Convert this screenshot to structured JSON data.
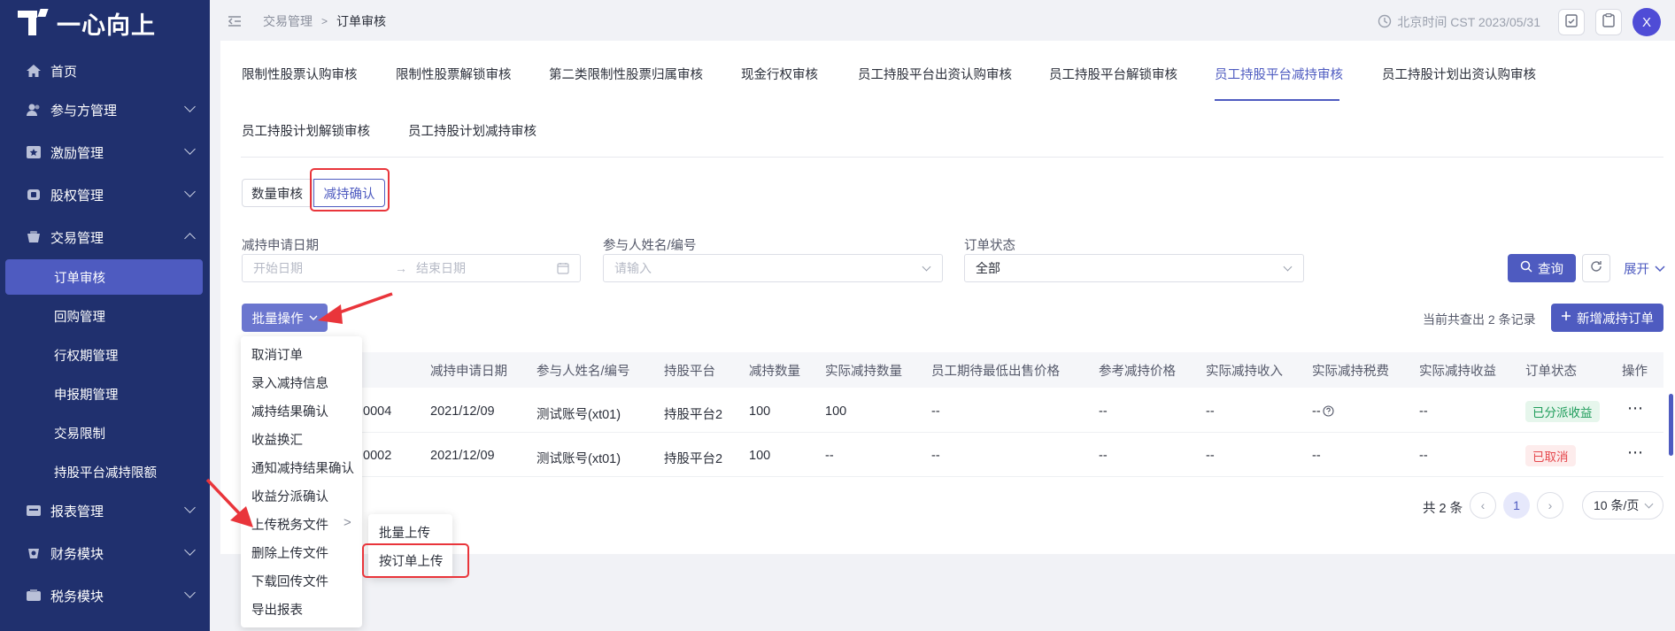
{
  "app": {
    "logo_text": "一心向上"
  },
  "sidebar": {
    "items": [
      {
        "label": "首页",
        "icon": "home-icon"
      },
      {
        "label": "参与方管理",
        "icon": "users-icon"
      },
      {
        "label": "激励管理",
        "icon": "star-icon"
      },
      {
        "label": "股权管理",
        "icon": "equity-icon"
      },
      {
        "label": "交易管理",
        "icon": "trade-icon"
      },
      {
        "label": "报表管理",
        "icon": "report-icon"
      },
      {
        "label": "财务模块",
        "icon": "finance-icon"
      },
      {
        "label": "税务模块",
        "icon": "tax-icon"
      }
    ],
    "sub_items": [
      "订单审核",
      "回购管理",
      "行权期管理",
      "申报期管理",
      "交易限制",
      "持股平台减持限额"
    ]
  },
  "topbar": {
    "breadcrumb": [
      "交易管理",
      "订单审核"
    ],
    "time": "北京时间 CST 2023/05/31",
    "avatar": "X"
  },
  "tabs": [
    "限制性股票认购审核",
    "限制性股票解锁审核",
    "第二类限制性股票归属审核",
    "现金行权审核",
    "员工持股平台出资认购审核",
    "员工持股平台解锁审核",
    "员工持股平台减持审核",
    "员工持股计划出资认购审核",
    "员工持股计划解锁审核",
    "员工持股计划减持审核"
  ],
  "segments": [
    "数量审核",
    "减持确认"
  ],
  "filters": {
    "date_label": "减持申请日期",
    "date_start_placeholder": "开始日期",
    "date_end_placeholder": "结束日期",
    "participant_label": "参与人姓名/编号",
    "participant_placeholder": "请输入",
    "status_label": "订单状态",
    "status_value": "全部",
    "query_button": "查询",
    "expand_link": "展开"
  },
  "toolbar": {
    "batch_button": "批量操作",
    "record_count": "当前共查出 2 条记录",
    "new_button": "新增减持订单"
  },
  "table": {
    "headers": [
      "减持申请日期",
      "参与人姓名/编号",
      "持股平台",
      "减持数量",
      "实际减持数量",
      "员工期待最低出售价格",
      "参考减持价格",
      "实际减持收入",
      "实际减持税费",
      "实际减持收益",
      "订单状态",
      "操作"
    ],
    "rows": [
      {
        "id_tail": "0004",
        "date": "2021/12/09",
        "participant": "测试账号(xt01)",
        "platform": "持股平台2",
        "qty": "100",
        "actual_qty": "100",
        "min_price": "--",
        "ref_price": "--",
        "income": "--",
        "tax": "--",
        "profit": "--",
        "status": "已分派收益",
        "status_color": "#1e9c5a",
        "status_bg": "#e6f6ec"
      },
      {
        "id_tail": "0002",
        "date": "2021/12/09",
        "participant": "测试账号(xt01)",
        "platform": "持股平台2",
        "qty": "100",
        "actual_qty": "--",
        "min_price": "--",
        "ref_price": "--",
        "income": "--",
        "tax": "--",
        "profit": "--",
        "status": "已取消",
        "status_color": "#e5484d",
        "status_bg": "#fdecec"
      }
    ]
  },
  "pager": {
    "total": "共 2 条",
    "current": "1",
    "page_size": "10 条/页"
  },
  "menu": {
    "items": [
      "取消订单",
      "录入减持信息",
      "减持结果确认",
      "收益换汇",
      "通知减持结果确认",
      "收益分派确认",
      "上传税务文件",
      "删除上传文件",
      "下载回传文件",
      "导出报表"
    ],
    "submenu": [
      "批量上传",
      "按订单上传"
    ]
  },
  "colors": {
    "accent": "#4e5bc0",
    "sidebar_bg": "#20306e",
    "highlight": "#e9353b"
  }
}
